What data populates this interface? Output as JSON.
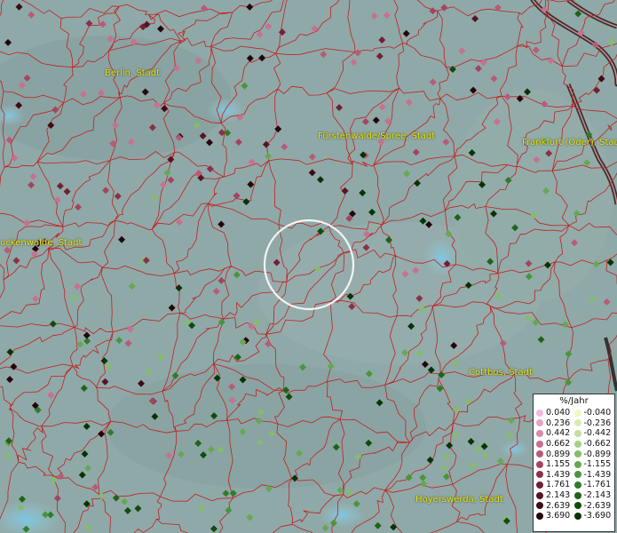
{
  "cities": [
    {
      "name": "Berlin, Stadt"
    },
    {
      "name": "Fürstenwalde/Spree, Stadt"
    },
    {
      "name": "Frankfurt (Oder), Stadt"
    },
    {
      "name": "uckenwalde, Stadt"
    },
    {
      "name": "Cottbus, Stadt"
    },
    {
      "name": "Hoyerswerda, Stadt"
    }
  ],
  "legend": {
    "title": "%/Jahr",
    "rows": [
      {
        "pos": "0.040",
        "pos_color": "#f4b8e4",
        "neg": "-0.040",
        "neg_color": "#f0f6c4"
      },
      {
        "pos": "0.236",
        "pos_color": "#e8a0c8",
        "neg": "-0.236",
        "neg_color": "#d8ecb4"
      },
      {
        "pos": "0.442",
        "pos_color": "#d98aad",
        "neg": "-0.442",
        "neg_color": "#bfe0a0"
      },
      {
        "pos": "0.662",
        "pos_color": "#c87090",
        "neg": "-0.662",
        "neg_color": "#a4d088"
      },
      {
        "pos": "0.899",
        "pos_color": "#b85a78",
        "neg": "-0.899",
        "neg_color": "#84bc6c"
      },
      {
        "pos": "1.155",
        "pos_color": "#a44460",
        "neg": "-1.155",
        "neg_color": "#66a852"
      },
      {
        "pos": "1.439",
        "pos_color": "#8c3048",
        "neg": "-1.439",
        "neg_color": "#4a943c"
      },
      {
        "pos": "1.761",
        "pos_color": "#722034",
        "neg": "-1.761",
        "neg_color": "#307c28"
      },
      {
        "pos": "2.143",
        "pos_color": "#581424",
        "neg": "-2.143",
        "neg_color": "#1e6418"
      },
      {
        "pos": "2.639",
        "pos_color": "#3e0a16",
        "neg": "-2.639",
        "neg_color": "#104c0c"
      },
      {
        "pos": "3.690",
        "pos_color": "#26040c",
        "neg": "-3.690",
        "neg_color": "#063404"
      }
    ]
  }
}
